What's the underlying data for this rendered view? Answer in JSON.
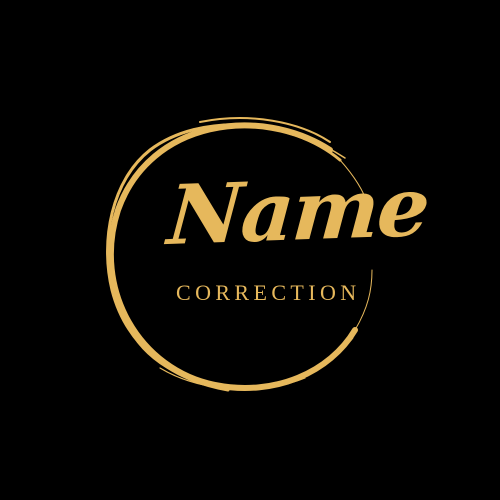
{
  "logo": {
    "title": "Name",
    "subtitle": "CORRECTION"
  },
  "colors": {
    "background": "#000000",
    "gold": "#E6B85C"
  },
  "icons": {
    "ring": "brush-stroke-circle-icon"
  }
}
